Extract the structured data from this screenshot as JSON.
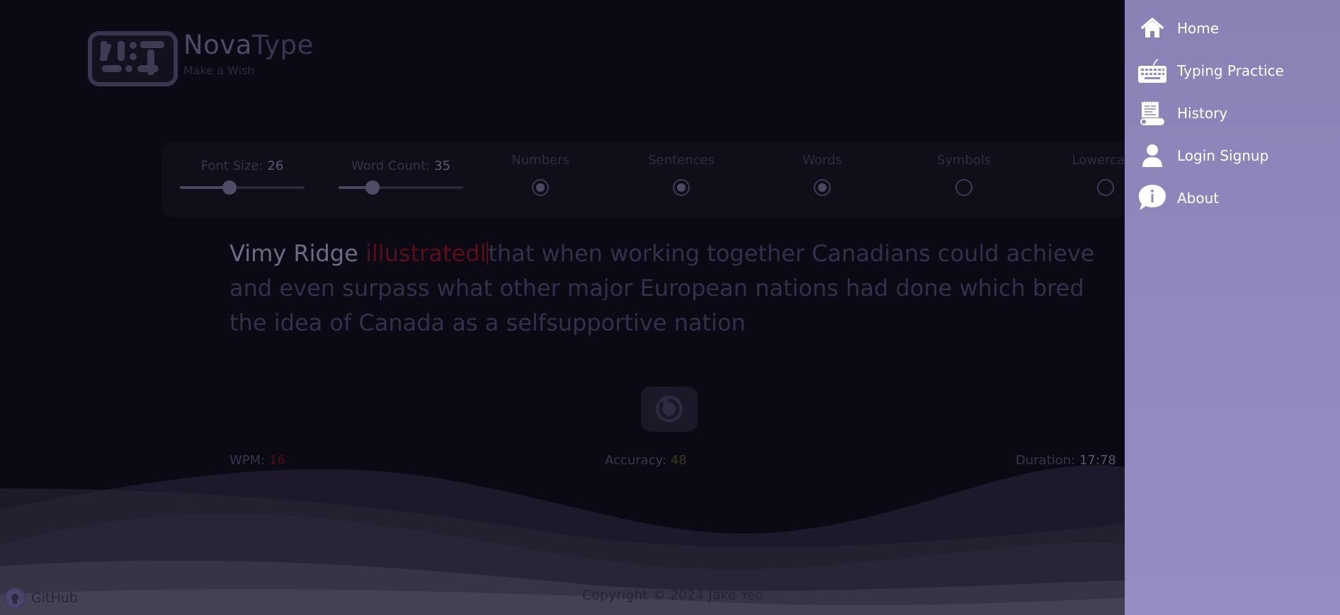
{
  "brand": {
    "name_part1": "Nova",
    "name_part2": "Type",
    "tagline": "Make a Wish",
    "logo_alt": "NT"
  },
  "settings": {
    "font_size": {
      "label": "Font Size: ",
      "value": "26",
      "fraction": 0.4
    },
    "word_count": {
      "label": "Word Count: ",
      "value": "35",
      "fraction": 0.27
    },
    "options": [
      {
        "label": "Numbers",
        "selected": true
      },
      {
        "label": "Sentences",
        "selected": true
      },
      {
        "label": "Words",
        "selected": true
      },
      {
        "label": "Symbols",
        "selected": false
      },
      {
        "label": "Lowercase",
        "selected": false
      }
    ]
  },
  "passage": {
    "typed": "Vimy Ridge ",
    "wrong": "illustratedl",
    "remaining": "that when working together Canadians could achieve and even surpass what other major European nations had done which bred the idea of Canada as a selfsupportive nation"
  },
  "stats": {
    "wpm_label": "WPM: ",
    "wpm_value": "16",
    "accuracy_label": "Accuracy: ",
    "accuracy_value": "48",
    "duration_label": "Duration: ",
    "duration_value": "17:78"
  },
  "footer": {
    "github_label": "GitHub",
    "copyright": "Copyright © 2024 Jake Yeo"
  },
  "nav": {
    "items": [
      {
        "label": "Home",
        "icon": "home-icon"
      },
      {
        "label": "Typing Practice",
        "icon": "keyboard-icon"
      },
      {
        "label": "History",
        "icon": "scroll-icon"
      },
      {
        "label": "Login Signup",
        "icon": "user-icon"
      },
      {
        "label": "About",
        "icon": "info-icon"
      }
    ]
  },
  "colors": {
    "background": "#0b0914",
    "sidebar": "#928ac0",
    "error": "#5a0f18"
  }
}
